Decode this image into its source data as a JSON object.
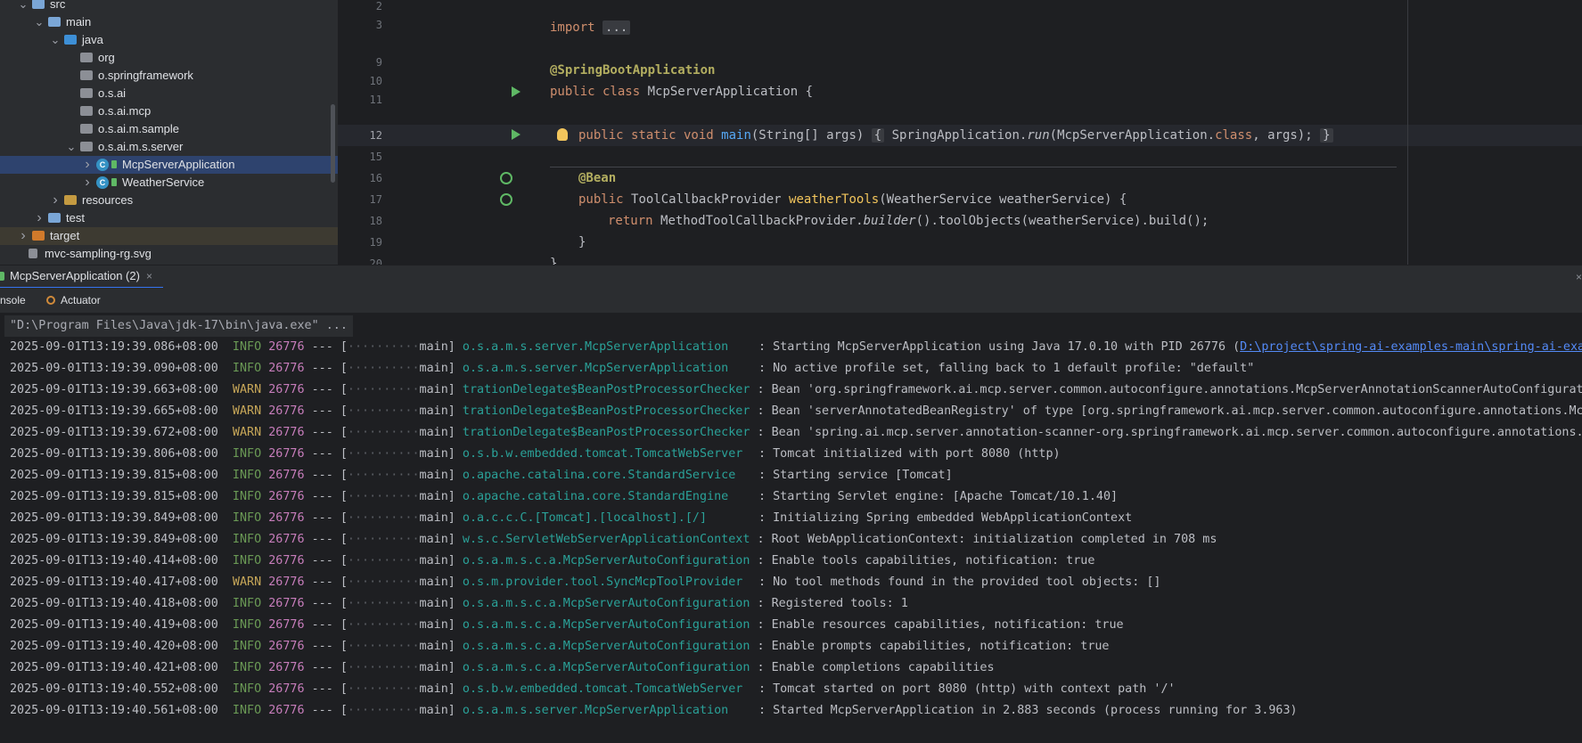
{
  "project_tree": {
    "items": [
      {
        "label": "src",
        "indent": 0,
        "expanded": true,
        "kind": "folder-src"
      },
      {
        "label": "main",
        "indent": 1,
        "expanded": true,
        "kind": "folder"
      },
      {
        "label": "java",
        "indent": 2,
        "expanded": true,
        "kind": "folder-source"
      },
      {
        "label": "org",
        "indent": 3,
        "kind": "package"
      },
      {
        "label": "o.springframework",
        "indent": 3,
        "kind": "package"
      },
      {
        "label": "o.s.ai",
        "indent": 3,
        "kind": "package"
      },
      {
        "label": "o.s.ai.mcp",
        "indent": 3,
        "kind": "package"
      },
      {
        "label": "o.s.ai.m.sample",
        "indent": 3,
        "kind": "package"
      },
      {
        "label": "o.s.ai.m.s.server",
        "indent": 3,
        "expanded": true,
        "kind": "package"
      },
      {
        "label": "McpServerApplication",
        "indent": 4,
        "expanded": false,
        "kind": "spring-class",
        "selected": true
      },
      {
        "label": "WeatherService",
        "indent": 4,
        "expanded": false,
        "kind": "class"
      },
      {
        "label": "resources",
        "indent": 2,
        "expanded": false,
        "kind": "folder-resources"
      },
      {
        "label": "test",
        "indent": 1,
        "expanded": false,
        "kind": "folder"
      },
      {
        "label": "target",
        "indent": 0,
        "expanded": false,
        "kind": "folder-excluded",
        "excluded": true
      },
      {
        "label": "mvc-sampling-rg.svg",
        "indent": 0,
        "kind": "file"
      }
    ]
  },
  "editor": {
    "line_numbers": [
      "2",
      "3",
      "9",
      "10",
      "11",
      "12",
      "15",
      "16",
      "17",
      "18",
      "19",
      "20"
    ],
    "current_line": "12",
    "code": {
      "l3_kw": "import",
      "l3_fold": "...",
      "l9_ann": "@SpringBootApplication",
      "l10_kw": "public class",
      "l10_rest": "McpServerApplication {",
      "l12_kw": "public static void",
      "l12_fn": "main",
      "l12_args": "(String[] args)",
      "l12_fold_open": "{",
      "l12_body_a": "SpringApplication.",
      "l12_run": "run",
      "l12_body_b": "(McpServerApplication.",
      "l12_class_kw": "class",
      "l12_body_c": ", args);",
      "l12_fold_close": "}",
      "l16_ann": "@Bean",
      "l17_kw": "public",
      "l17_type": "ToolCallbackProvider",
      "l17_fn": "weatherTools",
      "l17_rest": "(WeatherService weatherService) {",
      "l18_kw": "return",
      "l18_a": "MethodToolCallbackProvider.",
      "l18_builder": "builder",
      "l18_b": "().toolObjects(weatherService).build();",
      "l19": "}",
      "l20": "}"
    }
  },
  "run_panel": {
    "tab_label": "McpServerApplication (2)",
    "tab_close": "×",
    "panel_close": "×",
    "subtab_console": "nsole",
    "subtab_actuator": "Actuator"
  },
  "console": {
    "command": "\"D:\\Program Files\\Java\\jdk-17\\bin\\java.exe\" ...",
    "lines": [
      {
        "ts": "2025-09-01T13:19:39.086+08:00",
        "level": "INFO",
        "pid": "26776",
        "dots": "··········",
        "thread": "main]",
        "logger": "o.s.a.m.s.server.McpServerApplication",
        "msg": ": Starting McpServerApplication using Java 17.0.10 with PID 26776 (",
        "link": "D:\\project\\spring-ai-examples-main\\spring-ai-exam"
      },
      {
        "ts": "2025-09-01T13:19:39.090+08:00",
        "level": "INFO",
        "pid": "26776",
        "dots": "··········",
        "thread": "main]",
        "logger": "o.s.a.m.s.server.McpServerApplication",
        "msg": ": No active profile set, falling back to 1 default profile: \"default\""
      },
      {
        "ts": "2025-09-01T13:19:39.663+08:00",
        "level": "WARN",
        "pid": "26776",
        "dots": "··········",
        "thread": "main]",
        "logger": "trationDelegate$BeanPostProcessorChecker",
        "msg": ": Bean 'org.springframework.ai.mcp.server.common.autoconfigure.annotations.McpServerAnnotationScannerAutoConfigurati"
      },
      {
        "ts": "2025-09-01T13:19:39.665+08:00",
        "level": "WARN",
        "pid": "26776",
        "dots": "··········",
        "thread": "main]",
        "logger": "trationDelegate$BeanPostProcessorChecker",
        "msg": ": Bean 'serverAnnotatedBeanRegistry' of type [org.springframework.ai.mcp.server.common.autoconfigure.annotations.Mcp"
      },
      {
        "ts": "2025-09-01T13:19:39.672+08:00",
        "level": "WARN",
        "pid": "26776",
        "dots": "··········",
        "thread": "main]",
        "logger": "trationDelegate$BeanPostProcessorChecker",
        "msg": ": Bean 'spring.ai.mcp.server.annotation-scanner-org.springframework.ai.mcp.server.common.autoconfigure.annotations.M"
      },
      {
        "ts": "2025-09-01T13:19:39.806+08:00",
        "level": "INFO",
        "pid": "26776",
        "dots": "··········",
        "thread": "main]",
        "logger": "o.s.b.w.embedded.tomcat.TomcatWebServer",
        "msg": ": Tomcat initialized with port 8080 (http)"
      },
      {
        "ts": "2025-09-01T13:19:39.815+08:00",
        "level": "INFO",
        "pid": "26776",
        "dots": "··········",
        "thread": "main]",
        "logger": "o.apache.catalina.core.StandardService",
        "msg": ": Starting service [Tomcat]"
      },
      {
        "ts": "2025-09-01T13:19:39.815+08:00",
        "level": "INFO",
        "pid": "26776",
        "dots": "··········",
        "thread": "main]",
        "logger": "o.apache.catalina.core.StandardEngine",
        "msg": ": Starting Servlet engine: [Apache Tomcat/10.1.40]"
      },
      {
        "ts": "2025-09-01T13:19:39.849+08:00",
        "level": "INFO",
        "pid": "26776",
        "dots": "··········",
        "thread": "main]",
        "logger": "o.a.c.c.C.[Tomcat].[localhost].[/]",
        "msg": ": Initializing Spring embedded WebApplicationContext"
      },
      {
        "ts": "2025-09-01T13:19:39.849+08:00",
        "level": "INFO",
        "pid": "26776",
        "dots": "··········",
        "thread": "main]",
        "logger": "w.s.c.ServletWebServerApplicationContext",
        "msg": ": Root WebApplicationContext: initialization completed in 708 ms"
      },
      {
        "ts": "2025-09-01T13:19:40.414+08:00",
        "level": "INFO",
        "pid": "26776",
        "dots": "··········",
        "thread": "main]",
        "logger": "o.s.a.m.s.c.a.McpServerAutoConfiguration",
        "msg": ": Enable tools capabilities, notification: true"
      },
      {
        "ts": "2025-09-01T13:19:40.417+08:00",
        "level": "WARN",
        "pid": "26776",
        "dots": "··········",
        "thread": "main]",
        "logger": "o.s.m.provider.tool.SyncMcpToolProvider",
        "msg": ": No tool methods found in the provided tool objects: []"
      },
      {
        "ts": "2025-09-01T13:19:40.418+08:00",
        "level": "INFO",
        "pid": "26776",
        "dots": "··········",
        "thread": "main]",
        "logger": "o.s.a.m.s.c.a.McpServerAutoConfiguration",
        "msg": ": Registered tools: 1"
      },
      {
        "ts": "2025-09-01T13:19:40.419+08:00",
        "level": "INFO",
        "pid": "26776",
        "dots": "··········",
        "thread": "main]",
        "logger": "o.s.a.m.s.c.a.McpServerAutoConfiguration",
        "msg": ": Enable resources capabilities, notification: true"
      },
      {
        "ts": "2025-09-01T13:19:40.420+08:00",
        "level": "INFO",
        "pid": "26776",
        "dots": "··········",
        "thread": "main]",
        "logger": "o.s.a.m.s.c.a.McpServerAutoConfiguration",
        "msg": ": Enable prompts capabilities, notification: true"
      },
      {
        "ts": "2025-09-01T13:19:40.421+08:00",
        "level": "INFO",
        "pid": "26776",
        "dots": "··········",
        "thread": "main]",
        "logger": "o.s.a.m.s.c.a.McpServerAutoConfiguration",
        "msg": ": Enable completions capabilities"
      },
      {
        "ts": "2025-09-01T13:19:40.552+08:00",
        "level": "INFO",
        "pid": "26776",
        "dots": "··········",
        "thread": "main]",
        "logger": "o.s.b.w.embedded.tomcat.TomcatWebServer",
        "msg": ": Tomcat started on port 8080 (http) with context path '/'"
      },
      {
        "ts": "2025-09-01T13:19:40.561+08:00",
        "level": "INFO",
        "pid": "26776",
        "dots": "··········",
        "thread": "main]",
        "logger": "o.s.a.m.s.server.McpServerApplication",
        "msg": ": Started McpServerApplication in 2.883 seconds (process running for 3.963)"
      }
    ]
  },
  "colors": {
    "info": "#6a9955",
    "warn": "#c6a658",
    "pid": "#c77dbb",
    "logger": "#2aa198",
    "link": "#548af7",
    "selection": "#2e436e",
    "folder": "#7aa6d6",
    "folder_source": "#3d8fd6",
    "folder_resources": "#c49a41",
    "folder_excluded": "#d17a2b",
    "package": "#8c8f96"
  }
}
